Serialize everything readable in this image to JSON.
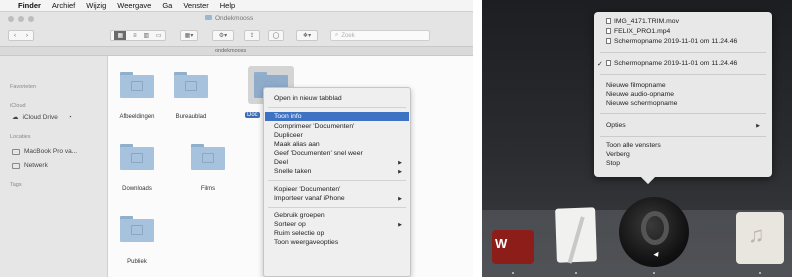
{
  "finder": {
    "menubar": [
      "Finder",
      "Archief",
      "Wijzig",
      "Weergave",
      "Ga",
      "Venster",
      "Help"
    ],
    "window_title": "Ondekmooss",
    "path_label": "ondekmooss",
    "search_placeholder": "Zoek",
    "sidebar": {
      "favorites_header": "Favorieten",
      "icloud_header": "iCloud",
      "icloud_drive": "iCloud Drive",
      "locations_header": "Locaties",
      "macbook": "MacBook Pro va...",
      "network": "Netwerk",
      "tags_header": "Tags"
    },
    "folders": [
      "Afbeeldingen",
      "Bureaublad",
      "Documenten",
      "Downloads",
      "Films",
      "Publiek"
    ],
    "selected_folder_label": "Doc",
    "context_menu": {
      "open_new_tab": "Open in nieuw tabblad",
      "get_info": "Toon info",
      "compress": "Comprimeer 'Documenten'",
      "duplicate": "Dupliceer",
      "make_alias": "Maak alias aan",
      "quick_look": "Geef 'Documenten' snel weer",
      "share": "Deel",
      "quick_actions": "Snelle taken",
      "copy": "Kopieer 'Documenten'",
      "import_iphone": "Importeer vanaf iPhone",
      "use_groups": "Gebruik groepen",
      "sort_by": "Sorteer op",
      "clean_up": "Ruim selectie op",
      "view_options": "Toon weergaveopties"
    }
  },
  "dock_menu": {
    "recent": [
      "IMG_4171.TRIM.mov",
      "FELIX_PRO1.mp4",
      "Schermopname 2019-11-01 om 11.24.46"
    ],
    "checked_item": "Schermopname 2019-11-01 om 11.24.46",
    "check_mark": "✓",
    "new_items": [
      "Nieuwe filmopname",
      "Nieuwe audio-opname",
      "Nieuwe schermopname"
    ],
    "options": "Opties",
    "show_all": "Toon alle vensters",
    "hide": "Verberg",
    "quit": "Stop"
  },
  "dock": {
    "word_letter": "W",
    "music_glyph": "♫"
  },
  "colors": {
    "menu_highlight": "#3e73c3",
    "folder_blue": "#a6c2dc",
    "word_red": "#8c1d18"
  }
}
